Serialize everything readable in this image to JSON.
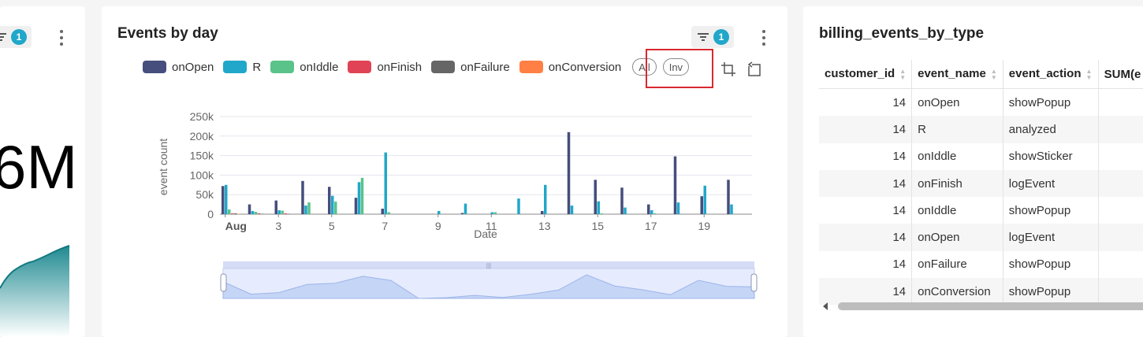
{
  "left_card": {
    "filter_count": "1",
    "big_number": "6M"
  },
  "middle_card": {
    "title": "Events by day",
    "filter_count": "1",
    "legend": [
      {
        "label": "onOpen",
        "color": "#454e7c"
      },
      {
        "label": "R",
        "color": "#20a7c9"
      },
      {
        "label": "onIddle",
        "color": "#59c38a"
      },
      {
        "label": "onFinish",
        "color": "#e04355"
      },
      {
        "label": "onFailure",
        "color": "#666666"
      },
      {
        "label": "onConversion",
        "color": "#ff7f44"
      }
    ],
    "select_all_label": "All",
    "select_inverse_label": "Inv"
  },
  "chart_data": {
    "type": "bar",
    "title": "",
    "xlabel": "Date",
    "ylabel": "event count",
    "ylim": [
      0,
      250000
    ],
    "y_ticks": [
      "0",
      "50k",
      "100k",
      "150k",
      "200k",
      "250k"
    ],
    "x_tick_labels": [
      "Aug",
      "3",
      "5",
      "7",
      "9",
      "11",
      "13",
      "15",
      "17",
      "19"
    ],
    "categories": [
      "Aug 1",
      "Aug 2",
      "Aug 3",
      "Aug 4",
      "Aug 5",
      "Aug 6",
      "Aug 7",
      "Aug 8",
      "Aug 9",
      "Aug 10",
      "Aug 11",
      "Aug 12",
      "Aug 13",
      "Aug 14",
      "Aug 15",
      "Aug 16",
      "Aug 17",
      "Aug 18",
      "Aug 19",
      "Aug 20"
    ],
    "grid": true,
    "series": [
      {
        "name": "onOpen",
        "color": "#454e7c",
        "values": [
          72000,
          25000,
          35000,
          85000,
          70000,
          42000,
          14000,
          0,
          0,
          3000,
          0,
          0,
          8000,
          210000,
          88000,
          68000,
          25000,
          148000,
          46000,
          88000
        ]
      },
      {
        "name": "R",
        "color": "#20a7c9",
        "values": [
          75000,
          8000,
          10000,
          22000,
          47000,
          82000,
          158000,
          0,
          8000,
          27000,
          5000,
          40000,
          75000,
          22000,
          33000,
          17000,
          10000,
          30000,
          73000,
          25000
        ]
      },
      {
        "name": "onIddle",
        "color": "#59c38a",
        "values": [
          12000,
          6000,
          9000,
          30000,
          32000,
          93000,
          5000,
          0,
          0,
          0,
          5000,
          0,
          0,
          0,
          2000,
          0,
          2000,
          0,
          0,
          0
        ]
      },
      {
        "name": "onFinish",
        "color": "#e04355",
        "values": [
          2000,
          2000,
          2000,
          0,
          0,
          0,
          0,
          0,
          0,
          0,
          0,
          0,
          0,
          0,
          0,
          0,
          0,
          0,
          0,
          0
        ]
      },
      {
        "name": "onFailure",
        "color": "#666666",
        "values": [
          2000,
          1000,
          1000,
          0,
          0,
          0,
          0,
          0,
          0,
          0,
          0,
          0,
          0,
          0,
          0,
          0,
          0,
          0,
          0,
          0
        ]
      },
      {
        "name": "onConversion",
        "color": "#ff7f44",
        "values": [
          1000,
          0,
          0,
          0,
          0,
          0,
          0,
          0,
          0,
          0,
          0,
          0,
          0,
          0,
          0,
          0,
          0,
          0,
          0,
          0
        ]
      }
    ],
    "data_zoom": {
      "range": [
        0,
        1
      ]
    }
  },
  "right_card": {
    "title": "billing_events_by_type",
    "columns": [
      "customer_id",
      "event_name",
      "event_action",
      "SUM(e"
    ],
    "rows": [
      [
        "14",
        "onOpen",
        "showPopup",
        ""
      ],
      [
        "14",
        "R",
        "analyzed",
        ""
      ],
      [
        "14",
        "onIddle",
        "showSticker",
        ""
      ],
      [
        "14",
        "onFinish",
        "logEvent",
        ""
      ],
      [
        "14",
        "onIddle",
        "showPopup",
        ""
      ],
      [
        "14",
        "onOpen",
        "logEvent",
        ""
      ],
      [
        "14",
        "onFailure",
        "showPopup",
        ""
      ],
      [
        "14",
        "onConversion",
        "showPopup",
        ""
      ]
    ]
  }
}
